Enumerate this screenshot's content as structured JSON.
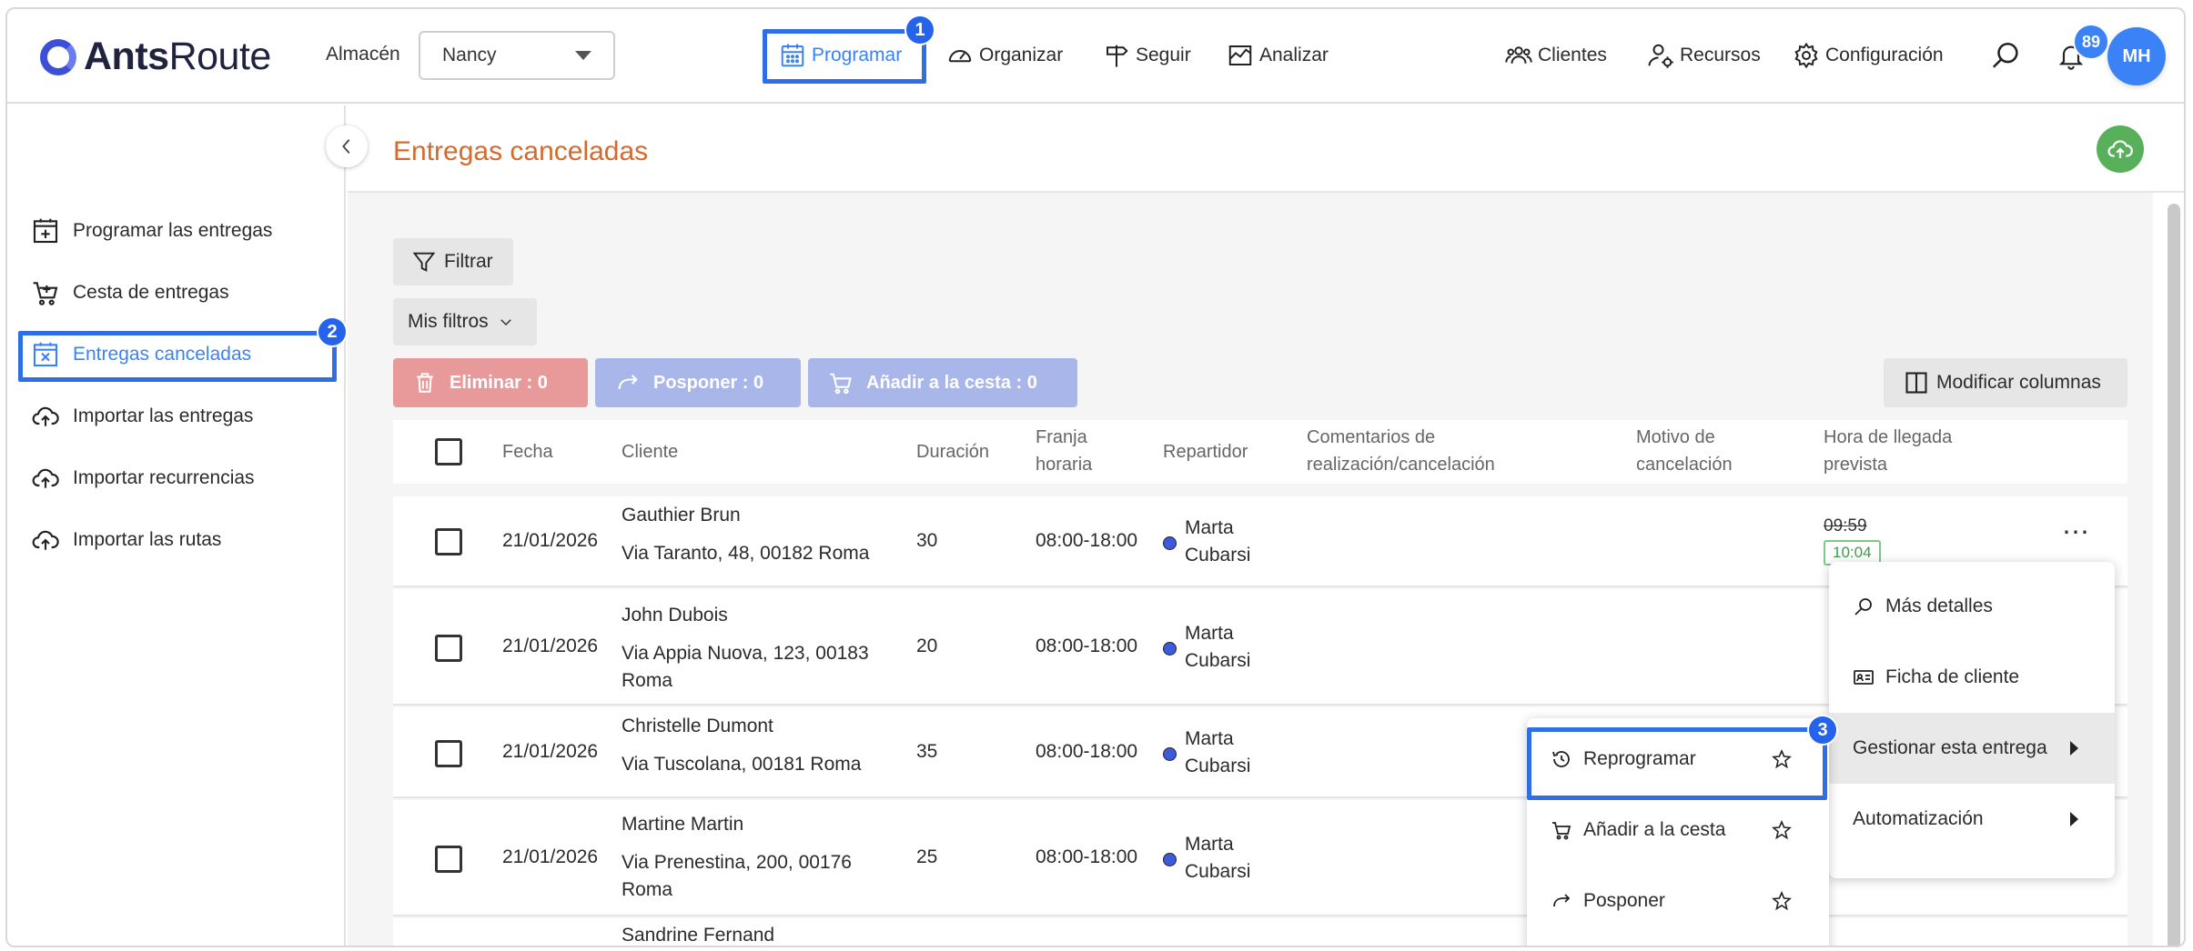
{
  "brand": {
    "name_bold": "Ants",
    "name_light": "Route"
  },
  "header": {
    "warehouse_label": "Almacén",
    "warehouse_value": "Nancy",
    "nav": {
      "schedule": "Programar",
      "organize": "Organizar",
      "track": "Seguir",
      "analyze": "Analizar",
      "clients": "Clientes",
      "resources": "Recursos",
      "settings": "Configuración"
    },
    "notifications_count": "89",
    "user_initials": "MH"
  },
  "steps": {
    "one": "1",
    "two": "2",
    "three": "3"
  },
  "sidebar": {
    "items": [
      {
        "label": "Programar las entregas"
      },
      {
        "label": "Cesta de entregas"
      },
      {
        "label": "Entregas canceladas"
      },
      {
        "label": "Importar las entregas"
      },
      {
        "label": "Importar recurrencias"
      },
      {
        "label": "Importar las rutas"
      }
    ]
  },
  "page": {
    "title": "Entregas canceladas"
  },
  "toolbar": {
    "filter": "Filtrar",
    "my_filters": "Mis filtros",
    "delete": "Eliminar : 0",
    "postpone": "Posponer : 0",
    "add_basket": "Añadir a la cesta : 0",
    "modify_columns": "Modificar columnas"
  },
  "table": {
    "headers": {
      "date": "Fecha",
      "client": "Cliente",
      "duration": "Duración",
      "slot_1": "Franja",
      "slot_2": "horaria",
      "driver": "Repartidor",
      "comments_1": "Comentarios de",
      "comments_2": "realización/cancelación",
      "reason_1": "Motivo de",
      "reason_2": "cancelación",
      "eta_1": "Hora de llegada",
      "eta_2": "prevista"
    },
    "rows": [
      {
        "date": "21/01/2026",
        "client": "Gauthier Brun",
        "address_1": "Via Taranto, 48, 00182 Roma",
        "address_2": "",
        "duration": "30",
        "slot": "08:00-18:00",
        "driver_1": "Marta",
        "driver_2": "Cubarsi",
        "eta_old": "09:59",
        "eta_new": "10:04"
      },
      {
        "date": "21/01/2026",
        "client": "John Dubois",
        "address_1": "Via Appia Nuova, 123, 00183",
        "address_2": "Roma",
        "duration": "20",
        "slot": "08:00-18:00",
        "driver_1": "Marta",
        "driver_2": "Cubarsi"
      },
      {
        "date": "21/01/2026",
        "client": "Christelle Dumont",
        "address_1": "Via Tuscolana, 00181 Roma",
        "address_2": "",
        "duration": "35",
        "slot": "08:00-18:00",
        "driver_1": "Marta",
        "driver_2": "Cubarsi"
      },
      {
        "date": "21/01/2026",
        "client": "Martine Martin",
        "address_1": "Via Prenestina, 200, 00176",
        "address_2": "Roma",
        "duration": "25",
        "slot": "08:00-18:00",
        "driver_1": "Marta",
        "driver_2": "Cubarsi"
      },
      {
        "client": "Sandrine Fernand"
      }
    ]
  },
  "context_menu": {
    "details": "Más detalles",
    "client_card": "Ficha de cliente",
    "manage": "Gestionar esta entrega",
    "automation": "Automatización"
  },
  "submenu": {
    "reschedule": "Reprogramar",
    "add_basket": "Añadir a la cesta",
    "postpone": "Posponer"
  },
  "colors": {
    "accent": "#3b82f6",
    "title": "#d46a2e",
    "highlight": "#2f6fe4",
    "delete_btn": "#e89a9a",
    "action_btn": "#a9b6ea",
    "upload": "#58b15a"
  }
}
